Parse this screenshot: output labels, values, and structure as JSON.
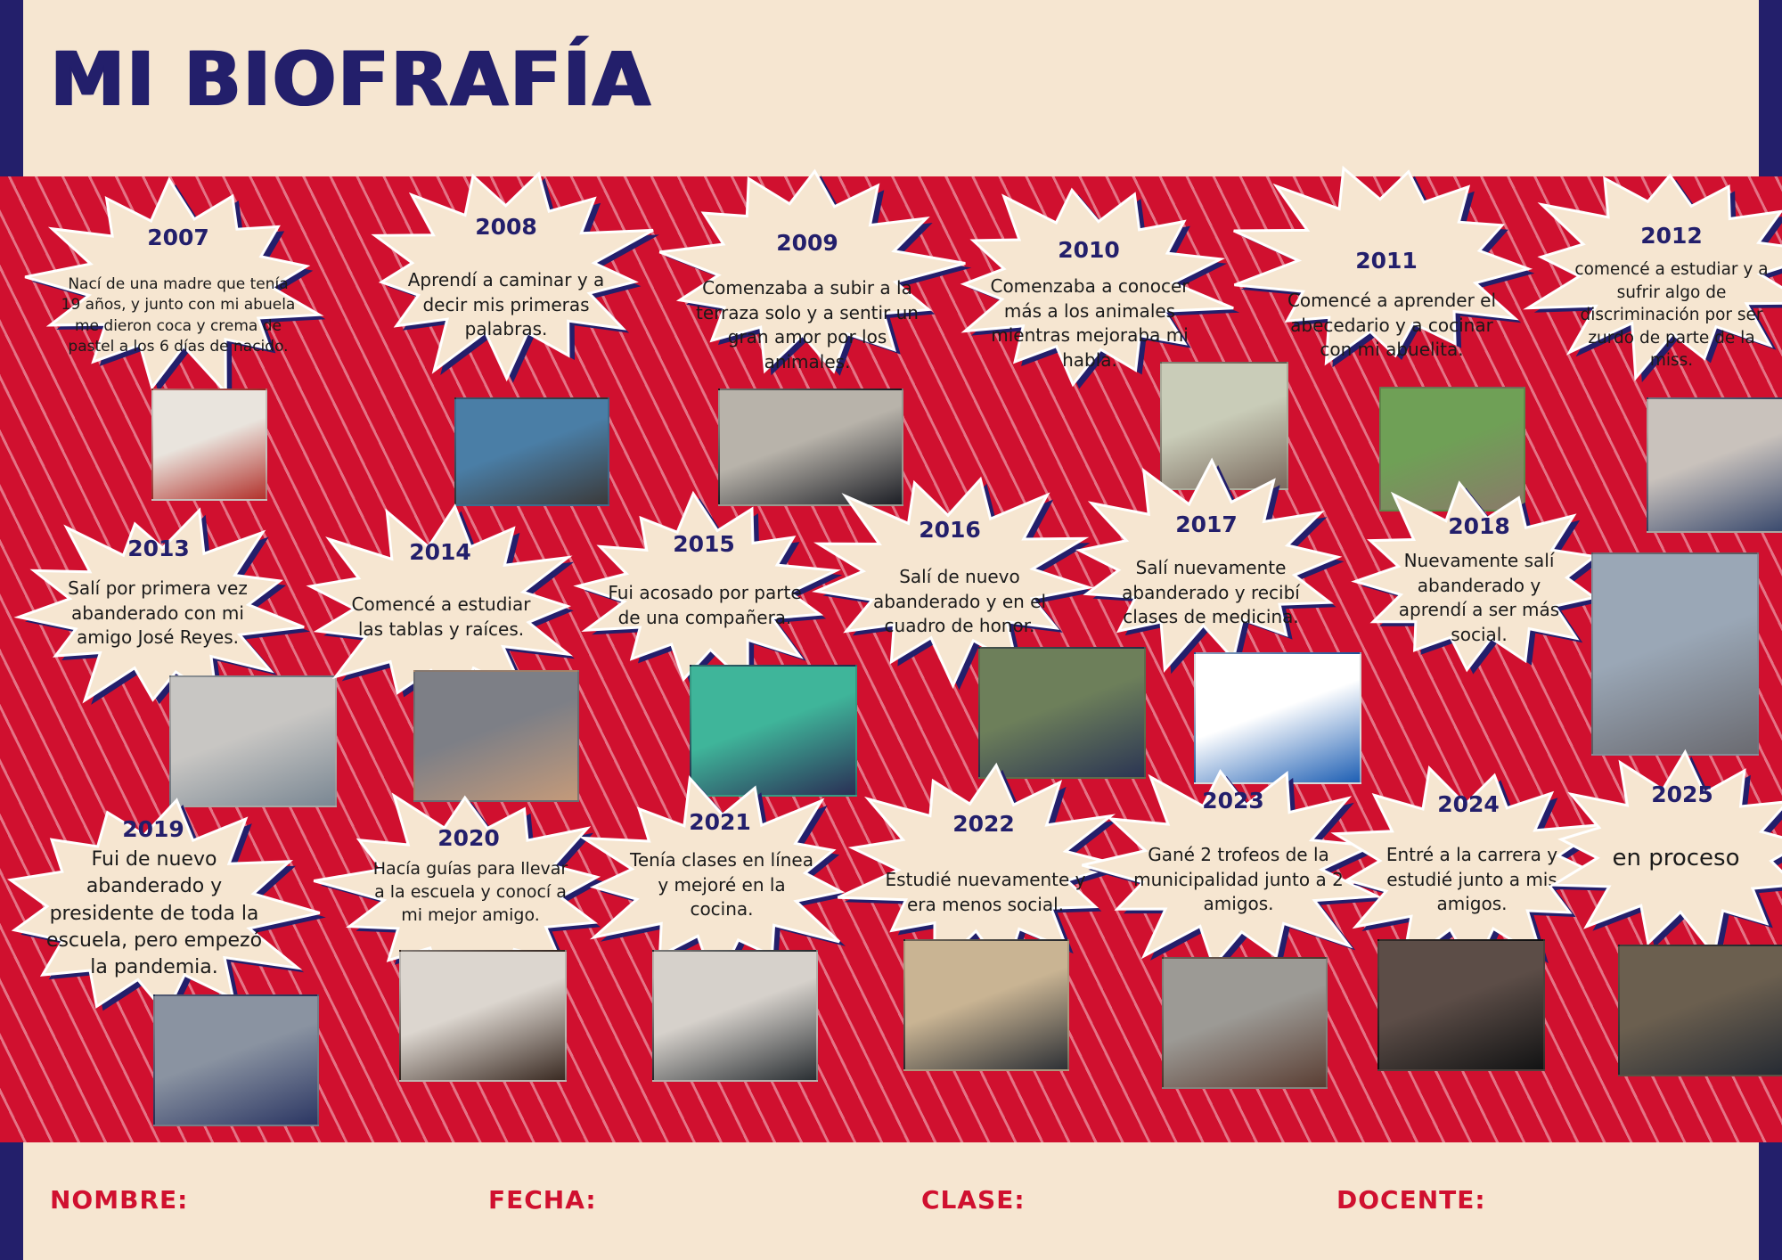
{
  "title": "MI BIOFRAFÍA",
  "colors": {
    "navy": "#231f6b",
    "red": "#d0102f",
    "cream": "#f6e6d1"
  },
  "entries": [
    {
      "year": "2007",
      "text": "Nací de una madre que tenía 19 años, y junto con mi abuela me dieron coca y crema de pastel a los 6 días de nacido."
    },
    {
      "year": "2008",
      "text": "Aprendí a caminar y a decir mis primeras palabras."
    },
    {
      "year": "2009",
      "text": "Comenzaba a subir a la terraza solo y a sentir un gran amor por los animales."
    },
    {
      "year": "2010",
      "text": "Comenzaba a conocer más a los animales mientras mejoraba mi habla."
    },
    {
      "year": "2011",
      "text": "Comencé a aprender el abecedario y a cocinar con mi abuelita."
    },
    {
      "year": "2012",
      "text": "comencé a estudiar y a sufrir algo de discriminación por ser zurdo de parte de la miss."
    },
    {
      "year": "2013",
      "text": "Salí por primera vez abanderado con mi amigo José Reyes."
    },
    {
      "year": "2014",
      "text": "Comencé a estudiar las tablas y raíces."
    },
    {
      "year": "2015",
      "text": "Fui acosado por parte de una compañera."
    },
    {
      "year": "2016",
      "text": "Salí de nuevo abanderado y en el cuadro de honor."
    },
    {
      "year": "2017",
      "text": "Salí nuevamente abanderado y recibí clases de medicina."
    },
    {
      "year": "2018",
      "text": "Nuevamente salí abanderado y aprendí a ser más social."
    },
    {
      "year": "2019",
      "text": "Fui de nuevo abanderado y presidente de toda la escuela, pero empezó la pandemia."
    },
    {
      "year": "2020",
      "text": "Hacía guías para llevar a la escuela y conocí a mi mejor amigo."
    },
    {
      "year": "2021",
      "text": "Tenía clases en línea y mejoré en la cocina."
    },
    {
      "year": "2022",
      "text": "Estudié nuevamente y era menos social."
    },
    {
      "year": "2023",
      "text": "Gané 2 trofeos de la municipalidad junto a 2 amigos."
    },
    {
      "year": "2024",
      "text": "Entré a la carrera y estudié junto a mis amigos."
    },
    {
      "year": "2025",
      "text": "en proceso"
    }
  ],
  "footer": {
    "nombre": "NOMBRE:",
    "fecha": "FECHA:",
    "clase": "CLASE:",
    "docente": "DOCENTE:"
  }
}
